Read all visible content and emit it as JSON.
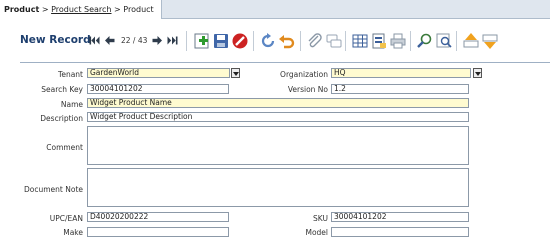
{
  "breadcrumb": {
    "root": "Product",
    "sep1": " > ",
    "link": "Product Search",
    "sep2": " > ",
    "current": "Product"
  },
  "toolbar": {
    "title": "New Record",
    "counter": "22 / 43",
    "icons": [
      "first-record-icon",
      "previous-record-icon",
      "next-record-icon",
      "last-record-icon",
      "new-record-icon",
      "save-icon",
      "delete-icon",
      "refresh-icon",
      "undo-icon",
      "attachment-icon",
      "chat-icon",
      "grid-toggle-icon",
      "report-icon",
      "print-icon",
      "zoom-across-icon",
      "find-icon",
      "parent-record-icon",
      "detail-record-icon"
    ]
  },
  "form": {
    "tenant": {
      "label": "Tenant",
      "value": "GardenWorld"
    },
    "organization": {
      "label": "Organization",
      "value": "HQ"
    },
    "search_key": {
      "label": "Search Key",
      "value": "30004101202"
    },
    "version_no": {
      "label": "Version No",
      "value": "1.2"
    },
    "name": {
      "label": "Name",
      "value": "Widget Product Name"
    },
    "description": {
      "label": "Description",
      "value": "Widget Product Description"
    },
    "comment": {
      "label": "Comment",
      "value": ""
    },
    "document_note": {
      "label": "Document Note",
      "value": ""
    },
    "upc": {
      "label": "UPC/EAN",
      "value": "D40020200222"
    },
    "sku": {
      "label": "SKU",
      "value": "30004101202"
    },
    "make": {
      "label": "Make",
      "value": ""
    },
    "model": {
      "label": "Model",
      "value": ""
    }
  },
  "colors": {
    "required_bg": "#fffbd0",
    "title_blue": "#1e3f6e",
    "tabbar_bg": "#dfe6ee"
  }
}
